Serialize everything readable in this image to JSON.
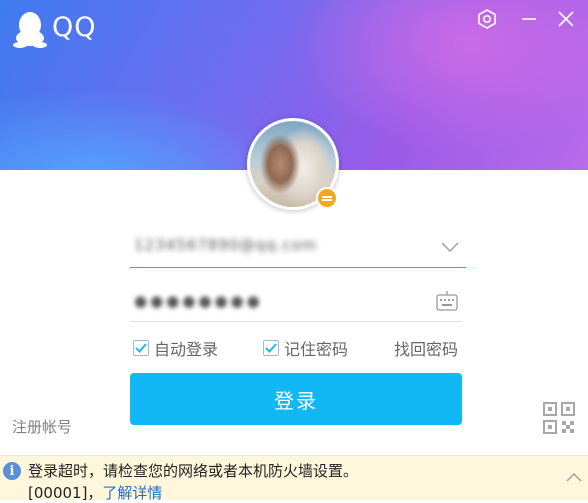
{
  "app": {
    "title": "QQ",
    "logo_icon": "penguin-icon"
  },
  "window_controls": {
    "settings_icon": "gear-icon",
    "minimize_icon": "minimize-icon",
    "close_icon": "close-icon"
  },
  "profile": {
    "avatar": "user-avatar",
    "status_icon": "status-busy-icon",
    "status_color": "#f5a623"
  },
  "account": {
    "value": "1234567890@qq.com",
    "dropdown_icon": "chevron-down-icon"
  },
  "password": {
    "value": "●●●●●●●●",
    "keyboard_icon": "keyboard-icon"
  },
  "options": {
    "auto_login": {
      "label": "自动登录",
      "checked": true
    },
    "remember_password": {
      "label": "记住密码",
      "checked": true
    },
    "find_password": "找回密码"
  },
  "login_button": {
    "label": "登录"
  },
  "register_link": "注册帐号",
  "qr_icon": "qr-code-icon",
  "error": {
    "message": "登录超时，请检查您的网络或者本机防火墙设置。",
    "code": "[00001]，",
    "link": "了解详情",
    "icon": "info-icon",
    "collapse_icon": "chevron-up-icon"
  },
  "colors": {
    "accent": "#12b7f5",
    "error_background": "#fff7db",
    "link": "#1d70c8"
  }
}
